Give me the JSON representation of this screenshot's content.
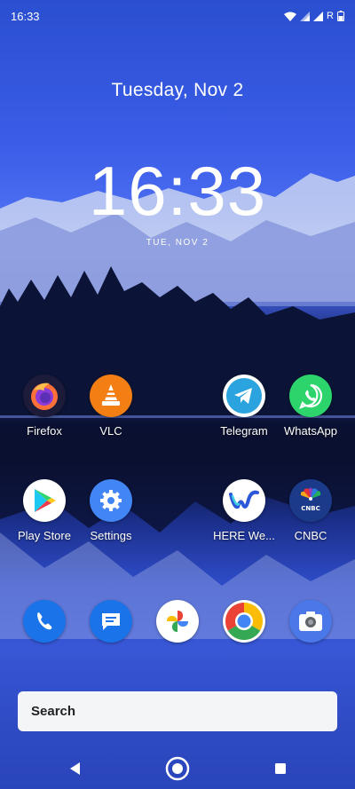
{
  "status_bar": {
    "time": "16:33",
    "roaming_label": "R",
    "icons": [
      "wifi-icon",
      "signal-icon",
      "signal-icon",
      "battery-icon"
    ]
  },
  "lockscreen": {
    "date_header": "Tuesday, Nov 2",
    "clock_time": "16:33",
    "clock_date": "TUE, NOV 2"
  },
  "apps": [
    {
      "label": "Firefox",
      "icon": "firefox-icon"
    },
    {
      "label": "VLC",
      "icon": "vlc-icon"
    },
    {
      "label": "Telegram",
      "icon": "telegram-icon"
    },
    {
      "label": "WhatsApp",
      "icon": "whatsapp-icon"
    },
    {
      "label": "Play Store",
      "icon": "play-store-icon"
    },
    {
      "label": "Settings",
      "icon": "settings-gear-icon"
    },
    {
      "label": "HERE We...",
      "icon": "here-wego-icon"
    },
    {
      "label": "CNBC",
      "icon": "cnbc-icon"
    }
  ],
  "dock": [
    "phone-icon",
    "messages-icon",
    "photos-icon",
    "chrome-icon",
    "camera-icon"
  ],
  "search": {
    "label": "Search"
  },
  "nav": [
    "back-icon",
    "home-icon",
    "recents-icon"
  ],
  "colors": {
    "sky": "#3a5ce8",
    "search_bg": "#f4f5f7",
    "accent_blue": "#1a73e8"
  }
}
